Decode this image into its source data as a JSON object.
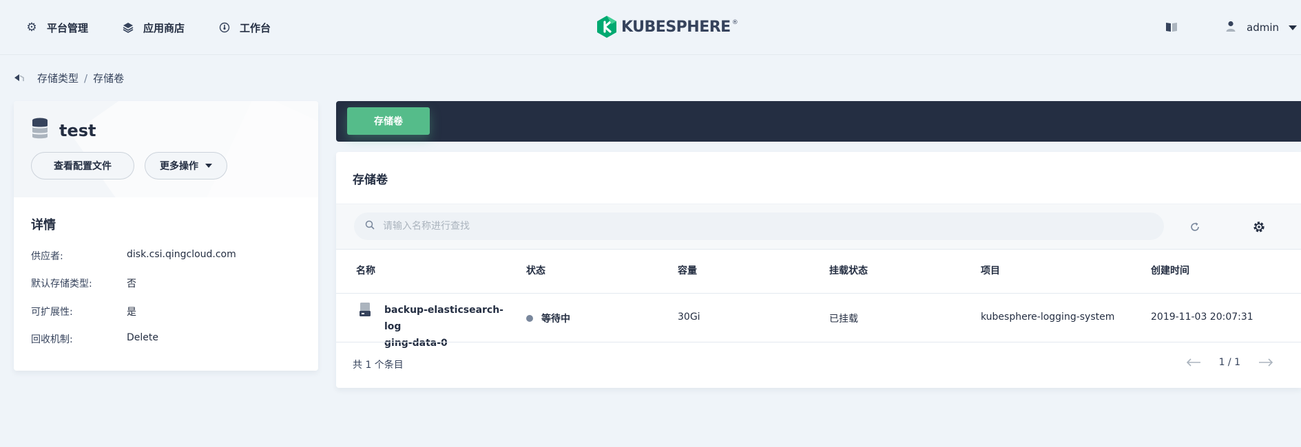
{
  "nav": {
    "items": [
      {
        "label": "平台管理",
        "icon": "gear-icon"
      },
      {
        "label": "应用商店",
        "icon": "layers-icon"
      },
      {
        "label": "工作台",
        "icon": "dashboard-icon"
      }
    ],
    "logo_text": "KUBESPHERE",
    "logo_reg": "®",
    "user": "admin"
  },
  "breadcrumb": {
    "items": [
      "存储类型",
      "存储卷"
    ],
    "separator": "/"
  },
  "left": {
    "title": "test",
    "buttons": {
      "view_config": "查看配置文件",
      "more_actions": "更多操作"
    },
    "details_title": "详情",
    "details": [
      {
        "key": "供应者:",
        "value": "disk.csi.qingcloud.com"
      },
      {
        "key": "默认存储类型:",
        "value": "否"
      },
      {
        "key": "可扩展性:",
        "value": "是"
      },
      {
        "key": "回收机制:",
        "value": "Delete"
      }
    ]
  },
  "toolbar": {
    "tab_label": "存储卷"
  },
  "panel": {
    "title": "存储卷",
    "search_placeholder": "请输入名称进行查找",
    "columns": [
      "名称",
      "状态",
      "容量",
      "挂载状态",
      "项目",
      "创建时间"
    ],
    "rows": [
      {
        "name_line1": "backup-elasticsearch-log",
        "name_line2": "ging-data-0",
        "status": "等待中",
        "capacity": "30Gi",
        "mount_status": "已挂载",
        "project": "kubesphere-logging-system",
        "created": "2019-11-03 20:07:31"
      }
    ],
    "total": "共 1 个条目",
    "page": "1 / 1"
  },
  "colors": {
    "accent_green": "#55bc8a",
    "toolbar_dark": "#242e42",
    "logo_green": "#00a971",
    "status_pending": "#79879c"
  }
}
